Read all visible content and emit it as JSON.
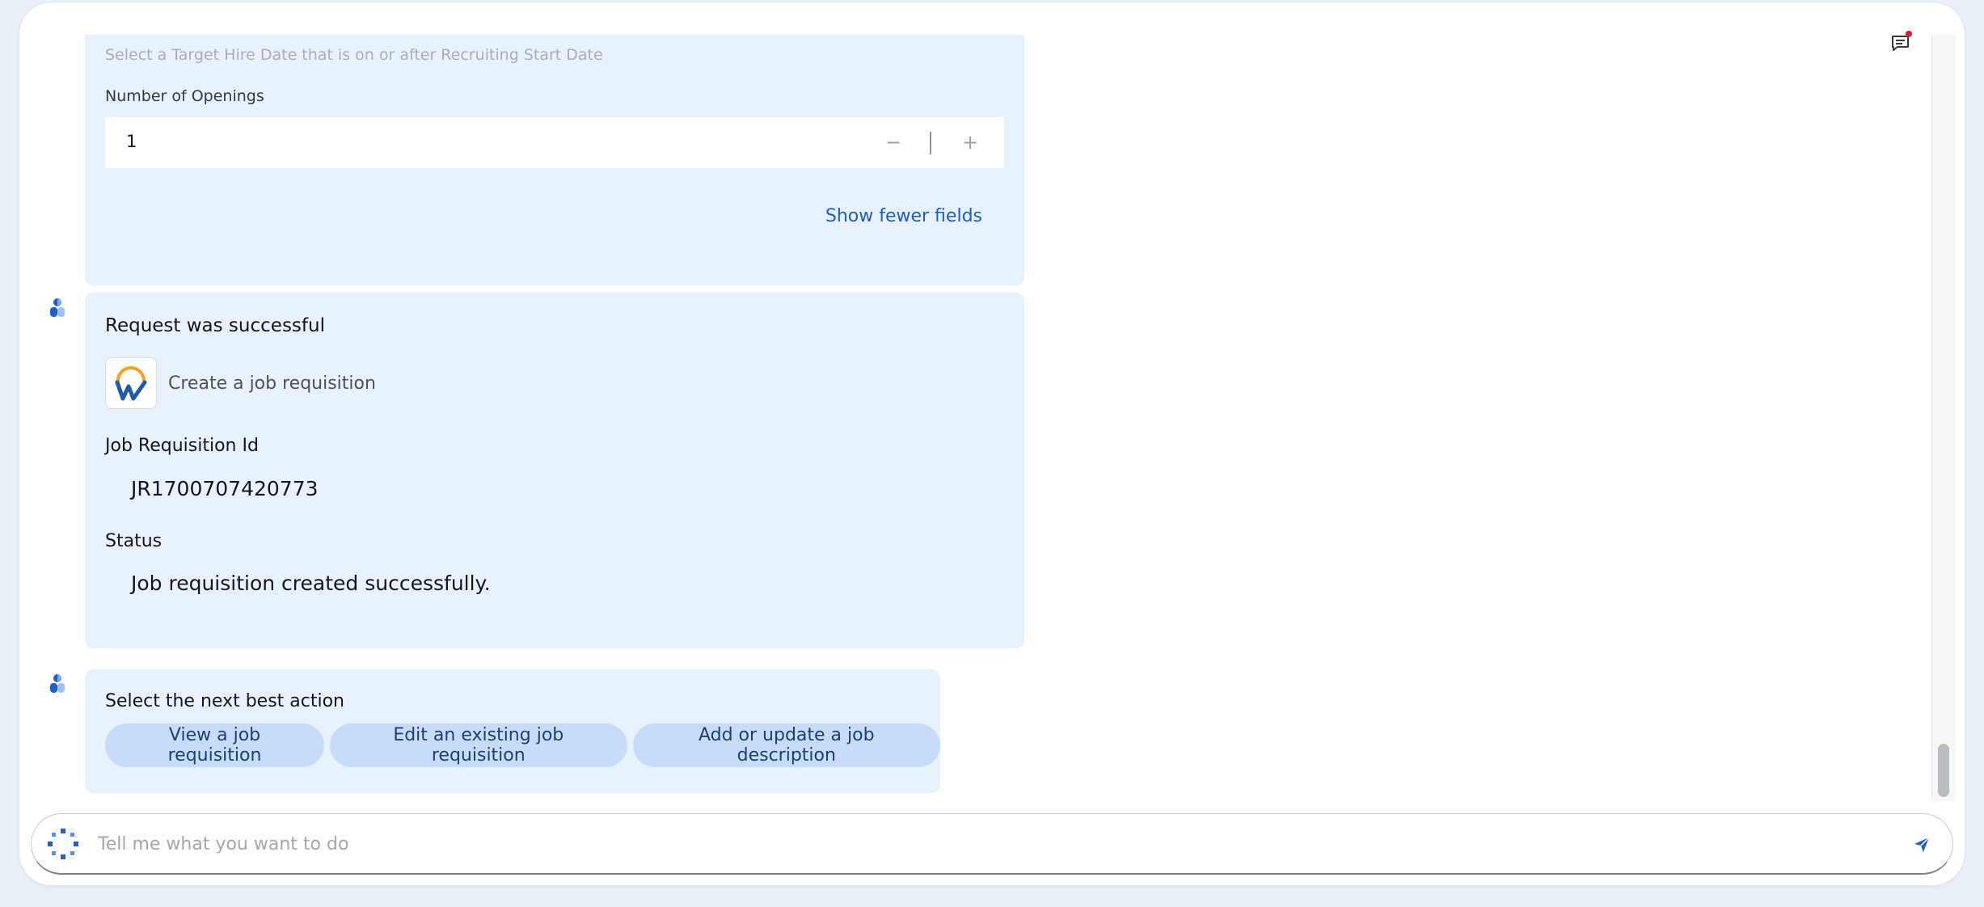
{
  "form_card": {
    "hint": "Select a Target Hire Date that is on or after Recruiting Start Date",
    "openings_label": "Number of Openings",
    "openings_value": "1",
    "show_fewer_label": "Show fewer fields"
  },
  "result_card": {
    "title": "Request was successful",
    "app_name": "Create a job requisition",
    "job_req_id_label": "Job Requisition Id",
    "job_req_id_value": "JR1700707420773",
    "status_label": "Status",
    "status_value": "Job requisition created successfully."
  },
  "actions_card": {
    "title": "Select the next best action",
    "chips": [
      {
        "label": "View a job requisition"
      },
      {
        "label": "Edit an existing job requisition"
      },
      {
        "label": "Add or update a job description"
      }
    ]
  },
  "composer": {
    "placeholder": "Tell me what you want to do"
  },
  "icons": {
    "avatar": "assistant-avatar-icon",
    "app_logo": "workday-logo",
    "notification": "chat-notification-icon",
    "composer_logo": "assistant-spinner-icon",
    "send": "send-icon"
  },
  "colors": {
    "card_bg": "#e8f1fe",
    "chip_bg": "#c6dcf9",
    "link": "#1d5ec9",
    "notification_dot": "#da1e28"
  }
}
